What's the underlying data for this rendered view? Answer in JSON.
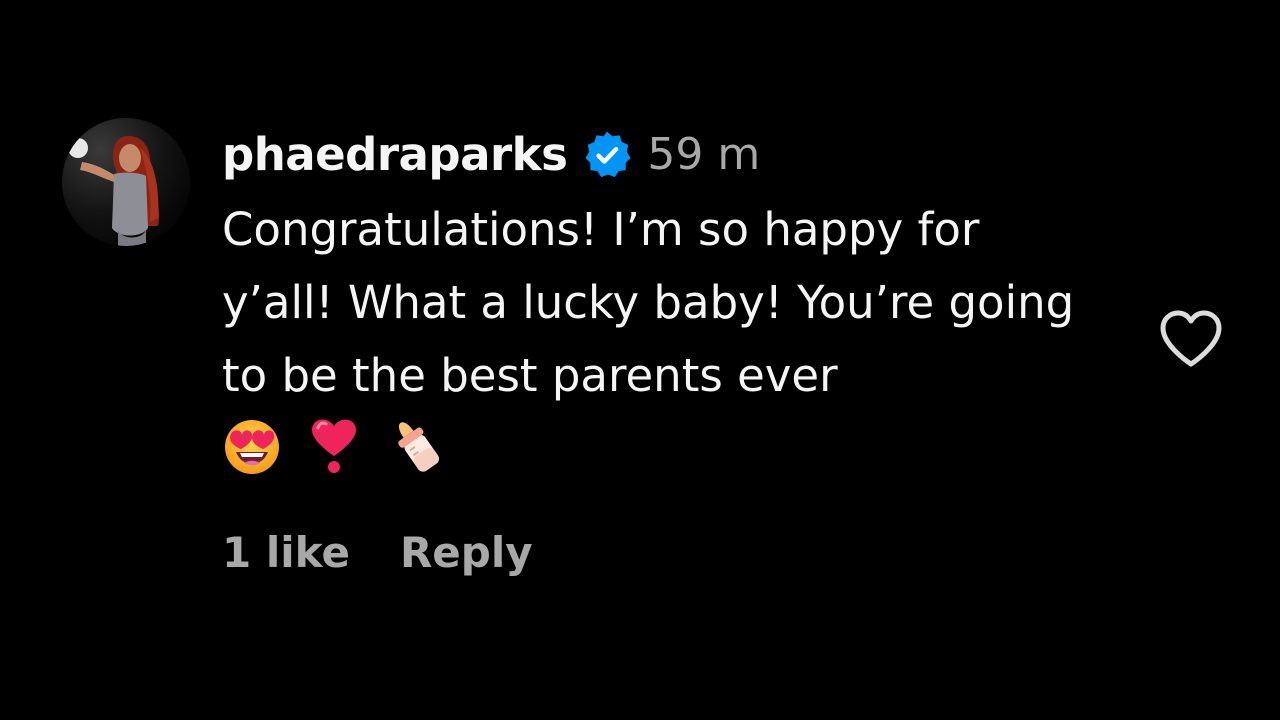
{
  "comment": {
    "username": "phaedraparks",
    "verified": true,
    "timestamp": "59 m",
    "text": "Congratulations! I’m so happy for y’all! What a lucky baby! You’re going to be the best parents ever",
    "emojis": [
      "smiling-face-with-heart-eyes",
      "heart-exclamation",
      "baby-bottle"
    ],
    "likes_label": "1 like",
    "reply_label": "Reply"
  },
  "icons": {
    "verified_badge": "verified-badge-icon",
    "like": "heart-outline-icon"
  },
  "colors": {
    "background": "#000000",
    "primary_text": "#f5f5f5",
    "secondary_text": "#a8a8a8",
    "verified_blue": "#0095f6",
    "heart_outline": "#dcdcdc"
  }
}
